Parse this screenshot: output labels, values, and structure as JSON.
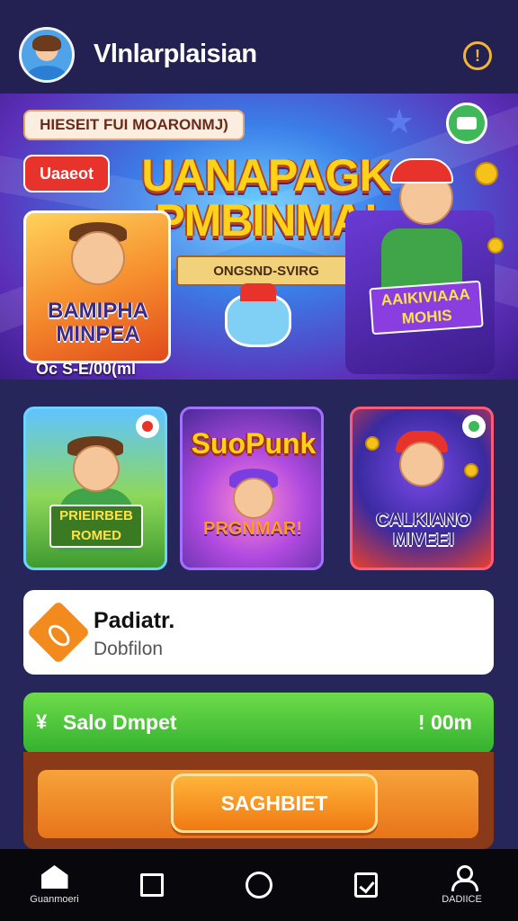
{
  "header": {
    "app_title": "Vlnlarplaisian",
    "alert_glyph": "!",
    "avatar_icon": "user-avatar"
  },
  "hero": {
    "top_badge": "HIESEIT FUI MOARONMJ)",
    "new_badge": "Uaaeot",
    "title_line1": "UANAPAGK",
    "title_line2": "PMBINMA!",
    "ribbon": "ONGSND-SVIRG",
    "left_card_text": "BAMIPHA MINPEA",
    "right_card_text": "AAIKIVIAAA MOHIS",
    "date_text": "Oc S-E/00(ml",
    "star_glyph": "★"
  },
  "tiles": [
    {
      "title": "PRIEIRBEB ROMED",
      "accent": "#6fd3ff"
    },
    {
      "title": "SuoPunk",
      "subtitle": "PRGNMAR!",
      "accent": "#a470ff"
    },
    {
      "title": "CALKIANO MIVEEI",
      "accent": "#ff5a7a"
    }
  ],
  "info_card": {
    "title": "Padiatr.",
    "subtitle": "Dobfilon",
    "icon": "orange-diamond-icon"
  },
  "status_bar": {
    "icon_glyph": "¥",
    "label": "Salo Dmpet",
    "time": "! 00m"
  },
  "action": {
    "button_label": "SAGHBIET"
  },
  "bottom_nav": [
    {
      "label": "Guanmoeri",
      "icon": "home-icon"
    },
    {
      "label": "",
      "icon": "square-icon"
    },
    {
      "label": "",
      "icon": "circle-icon"
    },
    {
      "label": "",
      "icon": "checklist-icon"
    },
    {
      "label": "DADIICE",
      "icon": "profile-icon"
    }
  ],
  "colors": {
    "background": "#27265a",
    "accent_green": "#33b02f",
    "accent_orange": "#f07a12",
    "alert": "#f2b531"
  }
}
